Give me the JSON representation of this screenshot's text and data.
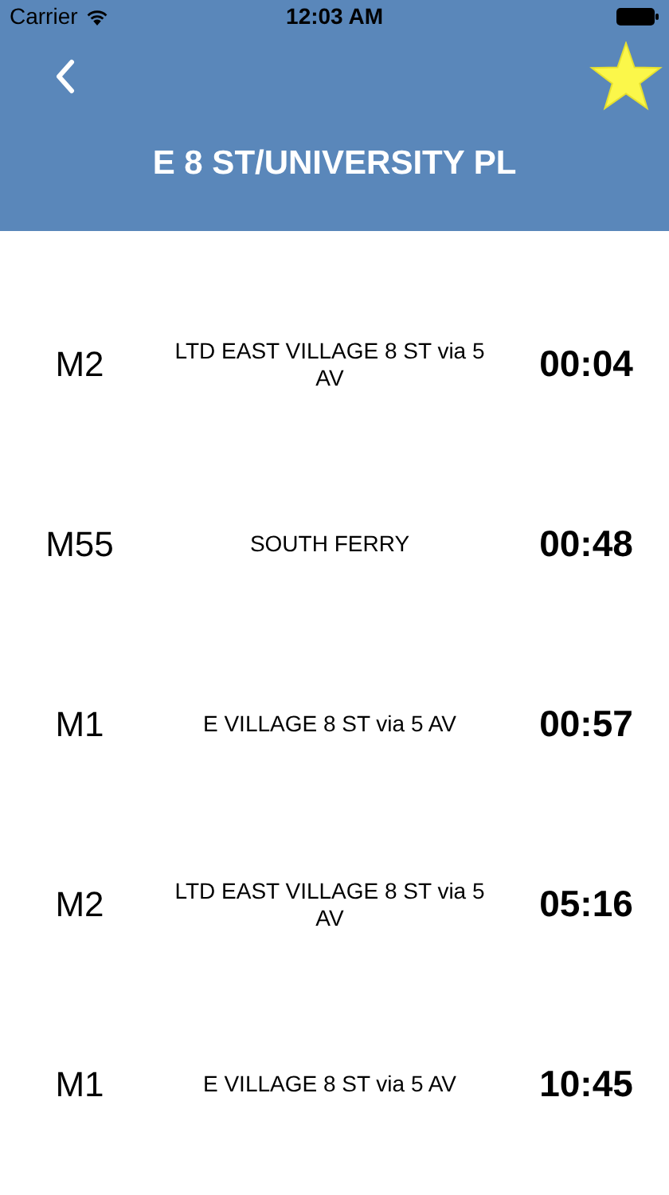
{
  "status_bar": {
    "carrier": "Carrier",
    "time": "12:03 AM"
  },
  "header": {
    "title": "E 8 ST/UNIVERSITY PL",
    "favorite": true
  },
  "arrivals": [
    {
      "route": "M2",
      "destination": "LTD EAST VILLAGE 8 ST via 5 AV",
      "time": "00:04"
    },
    {
      "route": "M55",
      "destination": "SOUTH FERRY",
      "time": "00:48"
    },
    {
      "route": "M1",
      "destination": "E VILLAGE 8 ST via 5 AV",
      "time": "00:57"
    },
    {
      "route": "M2",
      "destination": "LTD EAST VILLAGE 8 ST via 5 AV",
      "time": "05:16"
    },
    {
      "route": "M1",
      "destination": "E VILLAGE 8 ST via 5 AV",
      "time": "10:45"
    }
  ]
}
